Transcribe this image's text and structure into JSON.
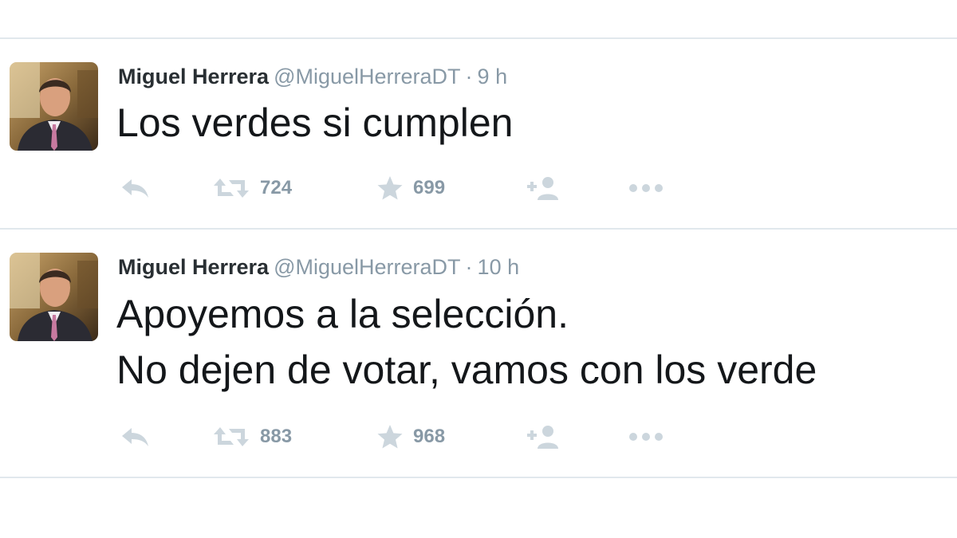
{
  "tweets": [
    {
      "name": "Miguel Herrera",
      "handle": "@MiguelHerreraDT",
      "separator": "·",
      "time": "9 h",
      "text_lines": [
        "Los verdes si cumplen"
      ],
      "retweets": "724",
      "favorites": "699",
      "icons": [
        "reply-icon",
        "retweet-icon",
        "star-icon",
        "follow-icon",
        "more-icon"
      ]
    },
    {
      "name": "Miguel Herrera",
      "handle": "@MiguelHerreraDT",
      "separator": "·",
      "time": "10 h",
      "text_lines": [
        "Apoyemos a la selección.",
        "No dejen de votar, vamos con los verde"
      ],
      "retweets": "883",
      "favorites": "968",
      "icons": [
        "reply-icon",
        "retweet-icon",
        "star-icon",
        "follow-icon",
        "more-icon"
      ]
    }
  ],
  "colors": {
    "name": "#292f33",
    "meta": "#8899a6",
    "text": "#14171a",
    "icon": "#ccd6dd",
    "divider": "#e1e8ed"
  }
}
